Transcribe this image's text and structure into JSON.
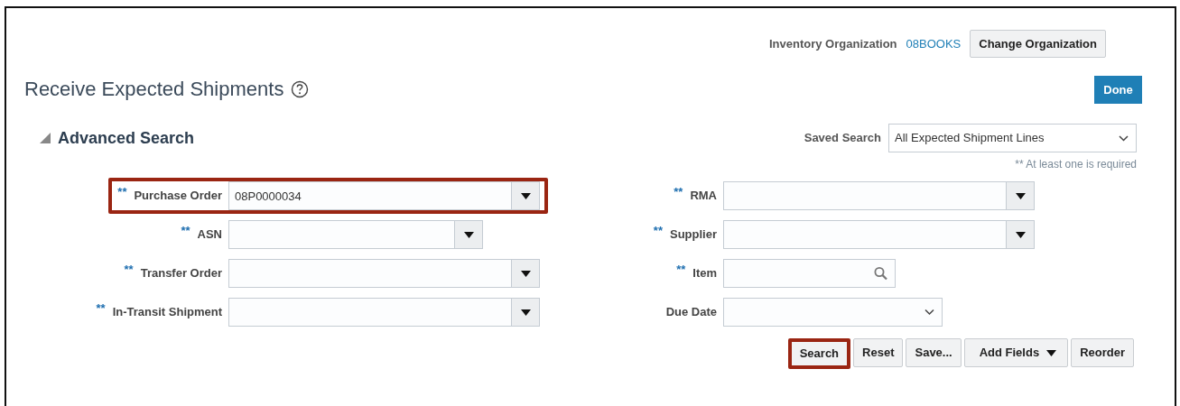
{
  "top_bar": {
    "label": "Inventory Organization",
    "organization": "08BOOKS",
    "button": "Change Organization"
  },
  "page": {
    "title": "Receive Expected Shipments",
    "done_button": "Done"
  },
  "search": {
    "title": "Advanced Search",
    "expanded": true,
    "saved_search": {
      "label": "Saved Search",
      "value": "All Expected Shipment Lines"
    },
    "note": "** At least one is required",
    "left_fields": [
      {
        "kind": "combobox",
        "marker": "**",
        "label": "Purchase Order",
        "value": "08P0000034",
        "highlighted": true
      },
      {
        "kind": "combobox",
        "marker": "**",
        "label": "ASN",
        "highlighted": false
      },
      {
        "kind": "combobox",
        "marker": "**",
        "label": "Transfer Order",
        "highlighted": false
      },
      {
        "kind": "combobox",
        "marker": "**",
        "label": "In-Transit Shipment",
        "highlighted": false
      }
    ],
    "right_fields": [
      {
        "kind": "combobox",
        "marker": "**",
        "label": "RMA",
        "highlighted": false
      },
      {
        "kind": "combobox",
        "marker": "**",
        "label": "Supplier",
        "highlighted": false
      },
      {
        "kind": "search",
        "marker": "**",
        "label": "Item",
        "highlighted": false
      },
      {
        "kind": "date",
        "label": "Due Date",
        "highlighted": false
      }
    ],
    "buttons": [
      {
        "label": "Search",
        "kind": "plain",
        "highlighted": true
      },
      {
        "label": "Reset",
        "kind": "plain",
        "highlighted": false
      },
      {
        "label": "Save...",
        "kind": "plain",
        "highlighted": false
      },
      {
        "label": "Add Fields",
        "kind": "menu",
        "highlighted": false
      },
      {
        "label": "Reorder",
        "kind": "plain",
        "highlighted": false
      }
    ]
  }
}
